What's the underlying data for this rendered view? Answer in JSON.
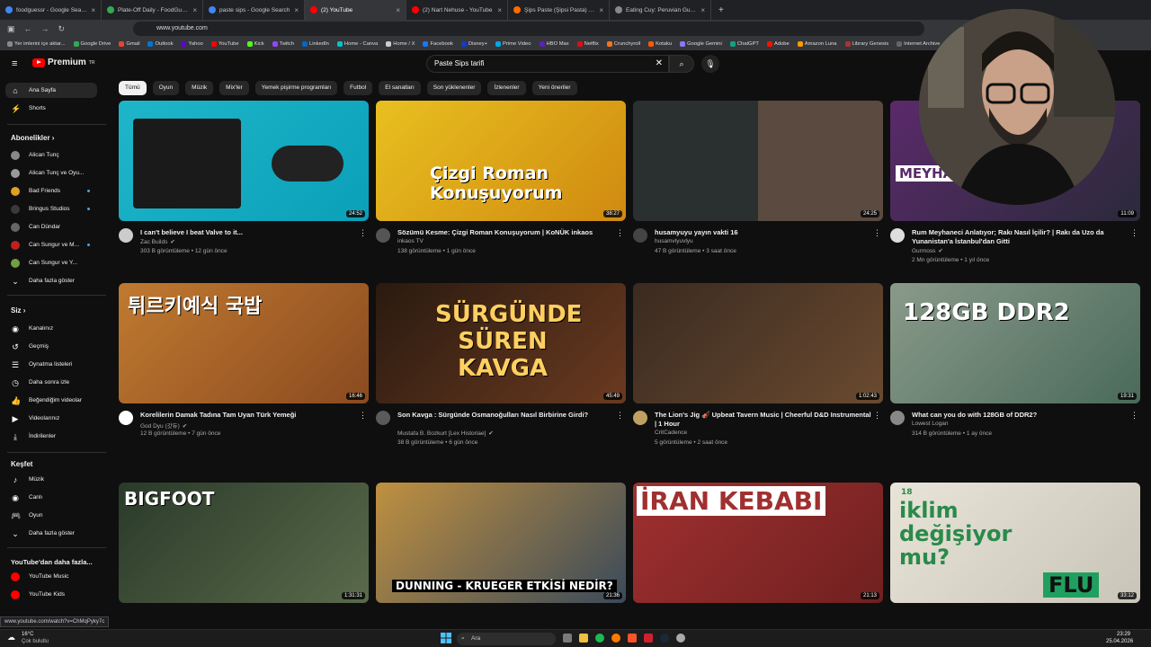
{
  "browser": {
    "tabs": [
      {
        "title": "foodguessr - Google Search",
        "color": "#4285f4"
      },
      {
        "title": "Plate-Off Daily - FoodGuessr | F",
        "color": "#34a853"
      },
      {
        "title": "paste sips - Google Search",
        "color": "#4285f4"
      },
      {
        "title": "(2) YouTube",
        "color": "#ff0000"
      },
      {
        "title": "(2) Nart Nehuse - YouTube",
        "color": "#ff0000"
      },
      {
        "title": "Şips Paste (Şipsi Pasta) - Nefis Y",
        "color": "#ff6b00"
      },
      {
        "title": "Eating Cuy: Peruvian Guinea Pig",
        "color": "#888888"
      }
    ],
    "url": "www.youtube.com",
    "bookmarks": [
      "Yer imlerini içe aktar...",
      "Google Drive",
      "Gmail",
      "Outlook",
      "Yahoo",
      "YouTube",
      "Kick",
      "Twitch",
      "LinkedIn",
      "Home - Canva",
      "Home / X",
      "Facebook",
      "Disney+",
      "Prime Video",
      "HBO Max",
      "Netflix",
      "Crunchyroll",
      "Kotaku",
      "Google Gemini",
      "ChatGPT",
      "Adobe",
      "Amazon Luna",
      "Library Genesis",
      "Internet Archive"
    ],
    "status_url": "www.youtube.com/watch?v=ChMqPyky7c"
  },
  "youtube": {
    "logo": "Premium",
    "logo_badge": "TR",
    "search_value": "Paste Sips tarifi",
    "chips": [
      "Tümü",
      "Oyun",
      "Müzik",
      "Mix'ler",
      "Yemek pişirme programları",
      "Futbol",
      "El sanatları",
      "Son yüklenenler",
      "İzlenenler",
      "Yeni öneriler"
    ]
  },
  "sidebar": {
    "home": "Ana Sayfa",
    "shorts": "Shorts",
    "subs_header": "Abonelikler",
    "subs": [
      {
        "label": "Alican Tunç",
        "color": "#888888"
      },
      {
        "label": "Alican Tunç ve Oyu...",
        "color": "#999999"
      },
      {
        "label": "Bad Friends",
        "color": "#e0a020"
      },
      {
        "label": "Bringus Studios",
        "color": "#3a3a3a"
      },
      {
        "label": "Can Dündar",
        "color": "#666666"
      },
      {
        "label": "Can Sungur ve M...",
        "color": "#c02020"
      },
      {
        "label": "Can Sungur ve Y...",
        "color": "#70a040"
      }
    ],
    "more_subs": "Daha fazla göster",
    "you_header": "Siz",
    "you": [
      "Kanalınız",
      "Geçmiş",
      "Oynatma listeleri",
      "Daha sonra izle",
      "Beğendiğim videolar",
      "Videolarınız",
      "İndirilenler"
    ],
    "explore_header": "Keşfet",
    "explore": [
      "Müzik",
      "Canlı",
      "Oyun"
    ],
    "explore_more": "Daha fazla göster",
    "more_header": "YouTube'dan daha fazla...",
    "more": [
      "YouTube Music",
      "YouTube Kids"
    ]
  },
  "videos": [
    {
      "title": "I can't believe I beat Valve to it...",
      "channel": "Zac Builds",
      "verified": true,
      "stats": "303 B görüntüleme • 12 gün önce",
      "duration": "24:52",
      "bg": "linear-gradient(135deg,#1fb5c9,#0aa0b8)",
      "art": "",
      "avatar": "#cccccc"
    },
    {
      "title": "Sözümü Kesme: Çizgi Roman Konuşuyorum | KoNÜK inkaos",
      "channel": "inkaos TV",
      "verified": false,
      "stats": "138 görüntüleme • 1 gün önce",
      "duration": "38:27",
      "bg": "linear-gradient(135deg,#e8c020,#d08a10)",
      "art": "Çizgi Roman Konuşuyorum",
      "avatar": "#555555"
    },
    {
      "title": "husamyuyu yayın vakti 16",
      "channel": "husamvlyuvlyu",
      "verified": false,
      "stats": "47 B görüntüleme • 3 saat önce",
      "duration": "24:25",
      "bg": "linear-gradient(90deg,#2a3030 50%,#5a4a40 50%)",
      "art": "",
      "avatar": "#444444"
    },
    {
      "title": "Rum Meyhaneci Anlatıyor; Rakı Nasıl İçilir? | Rakı da Uzo da Yunanistan'a İstanbul'dan Gitti",
      "channel": "Gurmoss",
      "verified": true,
      "stats": "2 Mn görüntüleme • 1 yıl önce",
      "duration": "11:09",
      "bg": "linear-gradient(135deg,#5a2a6a,#2a2a3a)",
      "art": "MEYHANECİ",
      "avatar": "#dddddd"
    },
    {
      "title": "Korelilerin Damak Tadına Tam Uyan Türk Yemeği",
      "channel": "God Dyu (갓듀)",
      "verified": true,
      "stats": "12 B görüntüleme • 7 gün önce",
      "duration": "16:46",
      "bg": "linear-gradient(135deg,#c07a30,#8a4a20)",
      "art": "튀르키예식 국밥",
      "avatar": "#ffffff"
    },
    {
      "title": "Son Kavga : Sürgünde Osmanoğulları Nasıl Birbirine Girdi?",
      "channel": "Mustafa B. Bozkurt [Lex Historiae]",
      "verified": true,
      "stats": "38 B görüntüleme • 6 gün önce",
      "duration": "45:49",
      "bg": "linear-gradient(135deg,#2a1a10,#6a3a20)",
      "art": "SÜRGÜNDE SÜREN KAVGA",
      "avatar": "#5a5a5a"
    },
    {
      "title": "The Lion's Jig 🎻 Upbeat Tavern Music | Cheerful D&D Instrumental | 1 Hour",
      "channel": "CritCadence",
      "verified": false,
      "stats": "5 görüntüleme • 2 saat önce",
      "duration": "1:02:43",
      "bg": "linear-gradient(135deg,#3a2a20,#6a4a30)",
      "art": "",
      "avatar": "#c0a060"
    },
    {
      "title": "What can you do with 128GB of DDR2?",
      "channel": "Lowest Logan",
      "verified": false,
      "stats": "314 B görüntüleme • 1 ay önce",
      "duration": "19:31",
      "bg": "linear-gradient(135deg,#8a9a8a,#4a6a5a)",
      "art": "128GB DDR2",
      "avatar": "#888888"
    },
    {
      "title": "",
      "channel": "",
      "verified": false,
      "stats": "",
      "duration": "1:31:31",
      "bg": "linear-gradient(135deg,#2a3a2a,#5a6a4a)",
      "art": "BIGFOOT",
      "avatar": "#555555"
    },
    {
      "title": "",
      "channel": "",
      "verified": false,
      "stats": "",
      "duration": "21:36",
      "bg": "linear-gradient(135deg,#c09040,#3a4a5a)",
      "art": "DUNNING - KRUEGER ETKİSİ NEDİR?",
      "avatar": "#555555"
    },
    {
      "title": "",
      "channel": "",
      "verified": false,
      "stats": "",
      "duration": "21:13",
      "bg": "linear-gradient(135deg,#a03030,#702020)",
      "art": "İRAN KEBABI",
      "avatar": "#555555"
    },
    {
      "title": "",
      "channel": "",
      "verified": false,
      "stats": "",
      "duration": "33:12",
      "bg": "linear-gradient(135deg,#e8e4d8,#c8c4b8)",
      "art": "iklim değişiyor mu?",
      "art_prefix": "18",
      "art_badge": "FLU",
      "avatar": "#555555"
    }
  ],
  "taskbar": {
    "weather_temp": "16°C",
    "weather_desc": "Çok bulutlu",
    "search": "Ara",
    "time": "23:29",
    "date": "25.04.2026"
  }
}
